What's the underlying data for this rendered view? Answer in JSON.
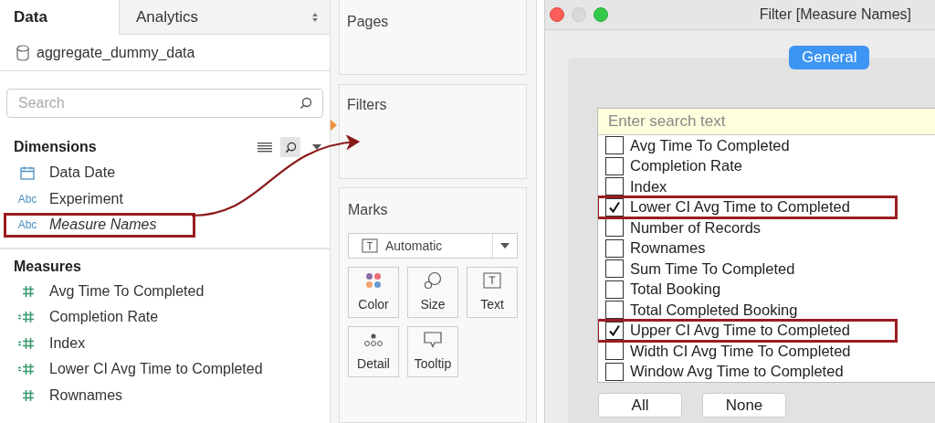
{
  "data_pane": {
    "tabs": [
      {
        "label": "Data",
        "selected": true
      },
      {
        "label": "Analytics",
        "selected": false
      }
    ],
    "data_source": "aggregate_dummy_data",
    "search": {
      "placeholder": "Search"
    },
    "dimensions": {
      "title": "Dimensions",
      "items": [
        {
          "label": "Data Date",
          "kind": "date",
          "italic": false,
          "highlighted": false
        },
        {
          "label": "Experiment",
          "kind": "string",
          "badge": "Abc",
          "italic": false,
          "highlighted": false
        },
        {
          "label": "Measure Names",
          "kind": "string",
          "badge": "Abc",
          "italic": true,
          "highlighted": true
        }
      ]
    },
    "measures": {
      "title": "Measures",
      "items": [
        {
          "label": "Avg Time To Completed",
          "kind": "measure"
        },
        {
          "label": "Completion Rate",
          "kind": "calculated"
        },
        {
          "label": "Index",
          "kind": "calculated"
        },
        {
          "label": "Lower CI Avg Time to Completed",
          "kind": "calculated"
        },
        {
          "label": "Rownames",
          "kind": "measure"
        }
      ]
    }
  },
  "shelves": {
    "pages": {
      "title": "Pages"
    },
    "filters": {
      "title": "Filters"
    },
    "marks": {
      "title": "Marks",
      "mark_type": "Automatic",
      "cards": [
        {
          "label": "Color",
          "kind": "color"
        },
        {
          "label": "Size",
          "kind": "size"
        },
        {
          "label": "Text",
          "kind": "text"
        },
        {
          "label": "Detail",
          "kind": "detail"
        },
        {
          "label": "Tooltip",
          "kind": "tooltip"
        }
      ]
    }
  },
  "dialog": {
    "title": "Filter [Measure Names]",
    "tabs": [
      {
        "label": "General",
        "selected": true
      }
    ],
    "search": {
      "placeholder": "Enter search text"
    },
    "items": [
      {
        "label": "Avg Time To Completed",
        "checked": false,
        "highlighted": false
      },
      {
        "label": "Completion Rate",
        "checked": false,
        "highlighted": false
      },
      {
        "label": "Index",
        "checked": false,
        "highlighted": false
      },
      {
        "label": "Lower CI Avg Time to Completed",
        "checked": true,
        "highlighted": true
      },
      {
        "label": "Number of Records",
        "checked": false,
        "highlighted": false
      },
      {
        "label": "Rownames",
        "checked": false,
        "highlighted": false
      },
      {
        "label": "Sum Time To Completed",
        "checked": false,
        "highlighted": false
      },
      {
        "label": "Total Booking",
        "checked": false,
        "highlighted": false
      },
      {
        "label": "Total Completed Booking",
        "checked": false,
        "highlighted": false
      },
      {
        "label": "Upper CI Avg Time to Completed",
        "checked": true,
        "highlighted": true
      },
      {
        "label": "Width CI Avg Time To Completed",
        "checked": false,
        "highlighted": false
      },
      {
        "label": "Window Avg Time to Completed",
        "checked": false,
        "highlighted": false
      }
    ],
    "buttons": [
      "All",
      "None"
    ]
  }
}
